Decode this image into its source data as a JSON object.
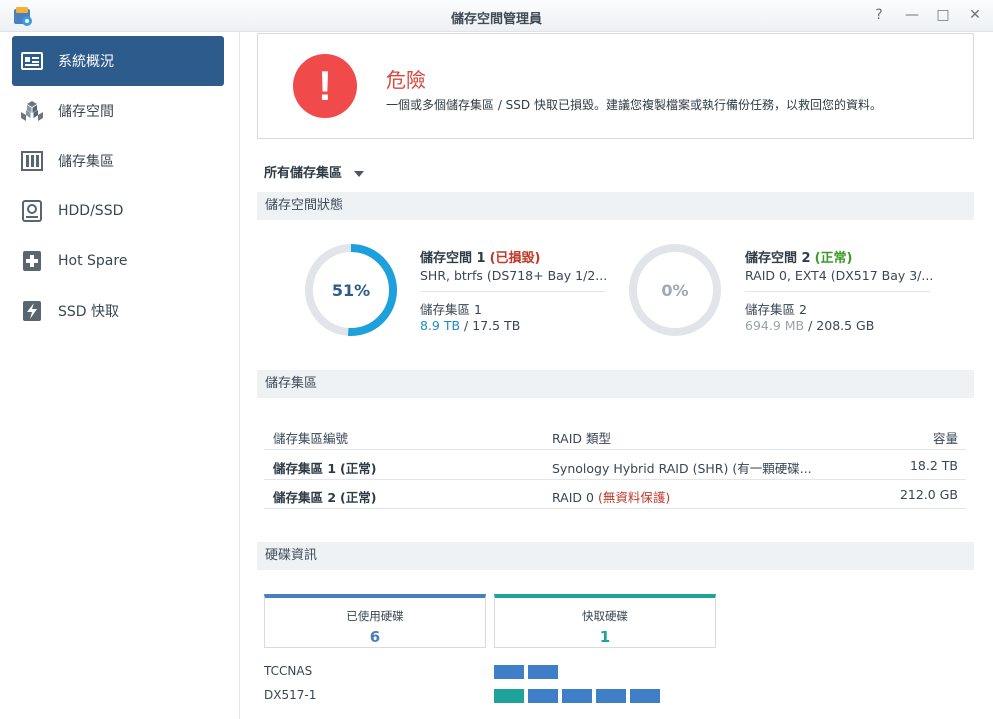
{
  "window": {
    "title": "儲存空間管理員",
    "buttons": {
      "help": "?",
      "minimize": "—",
      "maximize": "□",
      "close": "✕"
    }
  },
  "sidebar": {
    "items": [
      {
        "label": "系統概況",
        "icon": "overview-icon",
        "active": true
      },
      {
        "label": "儲存空間",
        "icon": "cubes-icon"
      },
      {
        "label": "儲存集區",
        "icon": "pool-icon"
      },
      {
        "label": "HDD/SSD",
        "icon": "hdd-icon"
      },
      {
        "label": "Hot Spare",
        "icon": "plus-box-icon"
      },
      {
        "label": "SSD 快取",
        "icon": "lightning-icon"
      }
    ]
  },
  "alert": {
    "icon": "!",
    "title": "危險",
    "message": "一個或多個儲存集區 / SSD 快取已損毀。建議您複製檔案或執行備份任務，以救回您的資料。"
  },
  "pool_selector": "所有儲存集區",
  "sections": {
    "volume_status": "儲存空間狀態",
    "storage_pools": "儲存集區",
    "disk_info": "硬碟資訊"
  },
  "volumes": [
    {
      "percent_label": "51%",
      "usage": 0.51,
      "title": "儲存空間 1",
      "status": "(已損毀)",
      "status_color": "#c0392b",
      "detail": "SHR, btrfs (DS718+ Bay 1/2...",
      "pool": "儲存集區 1",
      "used": "8.9 TB",
      "separator": " / ",
      "total": "17.5 TB"
    },
    {
      "percent_label": "0%",
      "usage": 0.0,
      "title": "儲存空間 2",
      "status": "(正常)",
      "status_color": "#3c9a2b",
      "detail": "RAID 0, EXT4 (DX517 Bay 3/...",
      "pool": "儲存集區 2",
      "used": "694.9 MB",
      "separator": " / ",
      "total": "208.5 GB"
    }
  ],
  "pool_table": {
    "headers": {
      "id": "儲存集區編號",
      "raid": "RAID 類型",
      "capacity": "容量"
    },
    "rows": [
      {
        "name": "儲存集區 1",
        "status": "(正常)",
        "raid": "Synology Hybrid RAID (SHR) (有一顆硬碟...",
        "raid_note": "",
        "capacity": "18.2 TB"
      },
      {
        "name": "儲存集區 2",
        "status": "(正常)",
        "raid": "RAID 0",
        "raid_note": "(無資料保護)",
        "capacity": "212.0 GB"
      }
    ]
  },
  "disk_cards": [
    {
      "label": "已使用硬碟",
      "value": "6",
      "color": "#4a7fbf"
    },
    {
      "label": "快取硬碟",
      "value": "1",
      "color": "#1ea39a"
    }
  ],
  "hosts": [
    {
      "name": "TCCNAS",
      "slots": [
        "#3f7fc8",
        "#3f7fc8"
      ]
    },
    {
      "name": "DX517-1",
      "slots": [
        "#1ea39a",
        "#3f7fc8",
        "#3f7fc8",
        "#3f7fc8",
        "#3f7fc8"
      ]
    }
  ]
}
